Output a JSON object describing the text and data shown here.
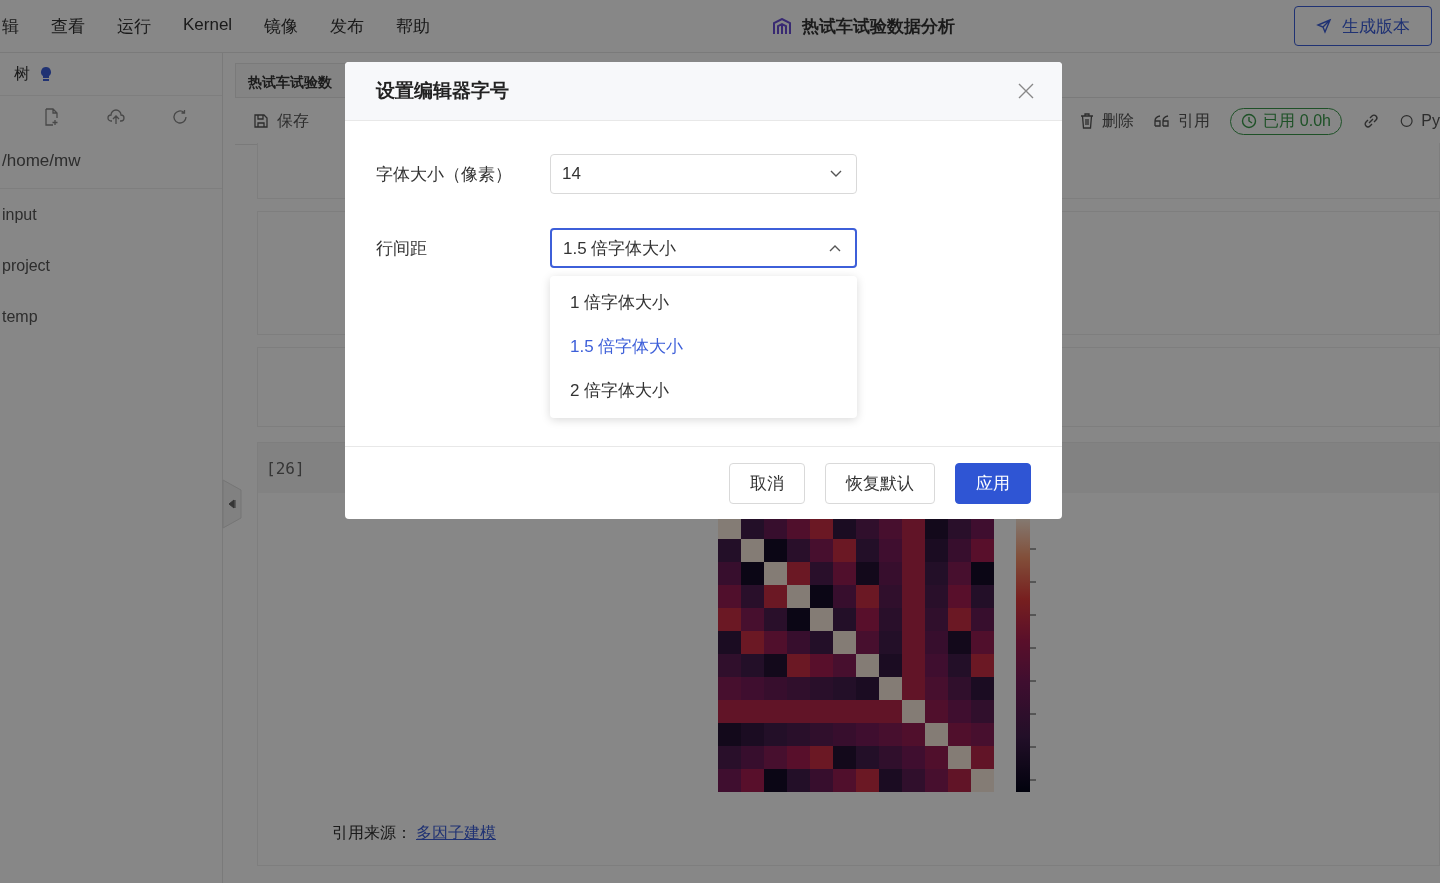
{
  "menu": [
    "辑",
    "查看",
    "运行",
    "Kernel",
    "镜像",
    "发布",
    "帮助"
  ],
  "app_title": "热试车试验数据分析",
  "publish_button": "生成版本",
  "sidebar": {
    "title": "树",
    "path": "/home/mw",
    "items": [
      "input",
      "project",
      "temp"
    ]
  },
  "tab": "热试车试验数",
  "toolbar": {
    "save": "保存",
    "delete": "删除",
    "cite": "引用",
    "usage": "已用 0.0h",
    "kernel": "Py"
  },
  "prompt": "[26]",
  "figure": {
    "kind": "heatmap"
  },
  "citation": {
    "label": "引用来源：",
    "link": "多因子建模"
  },
  "dialog": {
    "title": "设置编辑器字号",
    "fields": [
      {
        "label": "字体大小（像素）",
        "value": "14",
        "open": false
      },
      {
        "label": "行间距",
        "value": "1.5 倍字体大小",
        "open": true
      }
    ],
    "options": [
      {
        "label": "1 倍字体大小",
        "selected": false
      },
      {
        "label": "1.5 倍字体大小",
        "selected": true
      },
      {
        "label": "2 倍字体大小",
        "selected": false
      }
    ],
    "buttons": [
      {
        "label": "取消",
        "kind": "default"
      },
      {
        "label": "恢复默认",
        "kind": "default"
      },
      {
        "label": "应用",
        "kind": "primary"
      }
    ]
  }
}
